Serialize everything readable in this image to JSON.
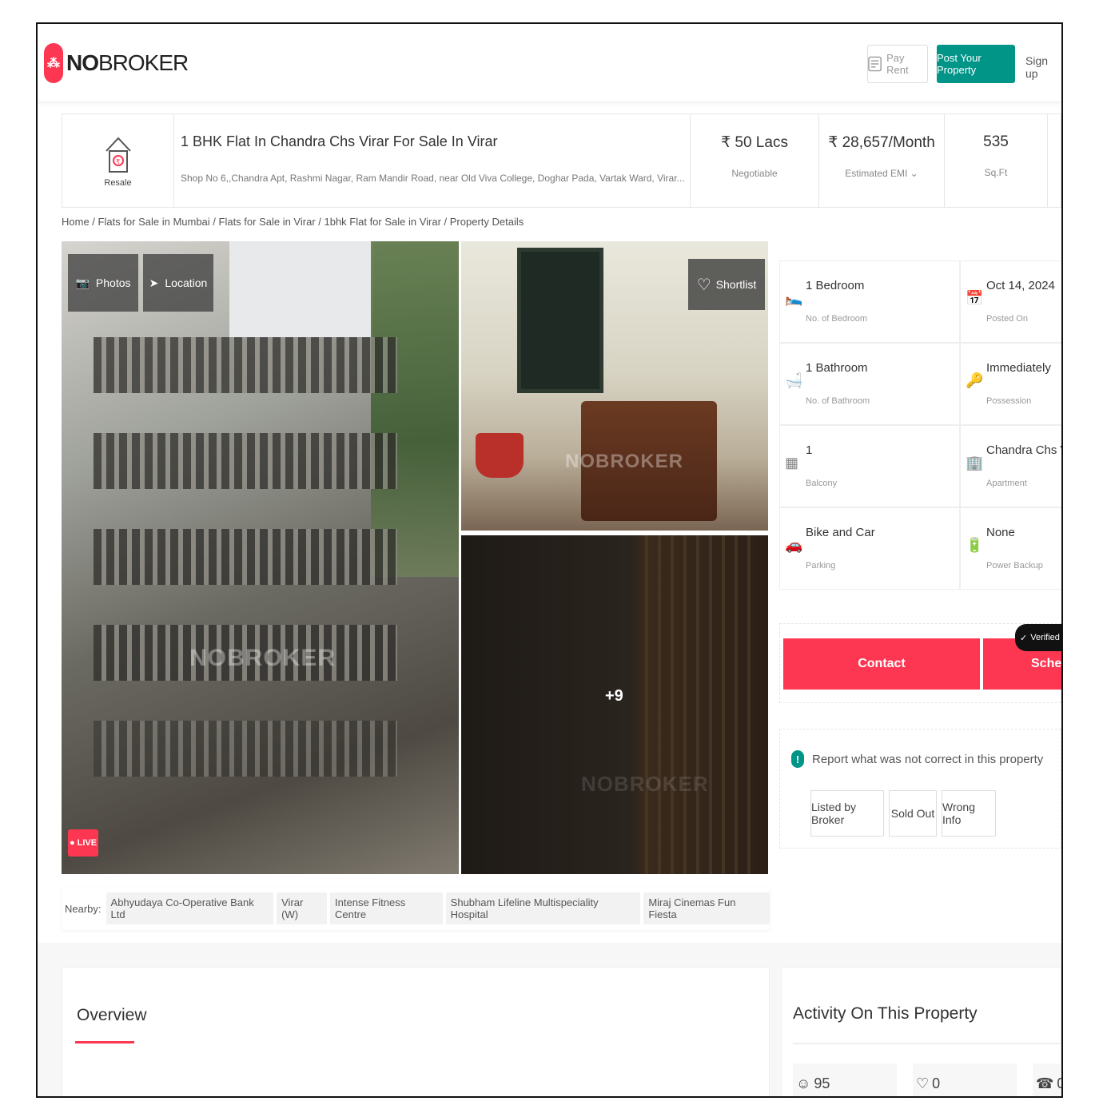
{
  "header": {
    "logo_no": "NO",
    "logo_broker": "BROKER",
    "pay_rent": "Pay Rent",
    "post_property": "Post Your Property",
    "sign_up": "Sign up"
  },
  "property": {
    "type_label": "Resale",
    "title": "1 BHK Flat In Chandra Chs Virar For Sale In Virar",
    "address": "Shop No 6,,Chandra Apt, Rashmi Nagar, Ram Mandir Road, near Old Viva College, Doghar Pada, Vartak Ward, Virar...",
    "price": "₹ 50 Lacs",
    "price_note": "Negotiable",
    "emi": "₹ 28,657/Month",
    "emi_note": "Estimated EMI",
    "area": "535",
    "area_unit": "Sq.Ft"
  },
  "breadcrumb": "Home / Flats for Sale in Mumbai / Flats for Sale in Virar / 1bhk Flat for Sale in Virar / Property Details",
  "gallery": {
    "photos_btn": "Photos",
    "location_btn": "Location",
    "shortlist_btn": "Shortlist",
    "live_badge": "LIVE",
    "more_count": "+9",
    "watermark": "NOBROKER"
  },
  "nearby": {
    "label": "Nearby:",
    "items": [
      "Abhyudaya Co-Operative Bank Ltd",
      "Virar (W)",
      "Intense Fitness Centre",
      "Shubham Lifeline Multispeciality Hospital",
      "Miraj Cinemas Fun Fiesta"
    ]
  },
  "details": [
    {
      "value": "1 Bedroom",
      "label": "No. of Bedroom",
      "icon": "bed-icon"
    },
    {
      "value": "Oct 14, 2024",
      "label": "Posted On",
      "icon": "calendar-icon"
    },
    {
      "value": "1 Bathroom",
      "label": "No. of Bathroom",
      "icon": "bathroom-icon"
    },
    {
      "value": "Immediately",
      "label": "Possession",
      "icon": "key-icon"
    },
    {
      "value": "1",
      "label": "Balcony",
      "icon": "balcony-icon"
    },
    {
      "value": "Chandra Chs Virar",
      "label": "Apartment",
      "icon": "building-icon"
    },
    {
      "value": "Bike and Car",
      "label": "Parking",
      "icon": "car-icon"
    },
    {
      "value": "None",
      "label": "Power Backup",
      "icon": "battery-icon"
    }
  ],
  "actions": {
    "contact": "Contact",
    "schedule": "Sched",
    "verified": "Verified Ava"
  },
  "report": {
    "message": "Report what was not correct in this property",
    "options": [
      "Listed by Broker",
      "Sold Out",
      "Wrong Info"
    ]
  },
  "overview": {
    "title": "Overview"
  },
  "activity": {
    "title": "Activity On This Property",
    "views": "95",
    "shortlists": "0",
    "contacts": "0"
  },
  "colors": {
    "brand": "#fd3752",
    "accent": "#009587"
  }
}
